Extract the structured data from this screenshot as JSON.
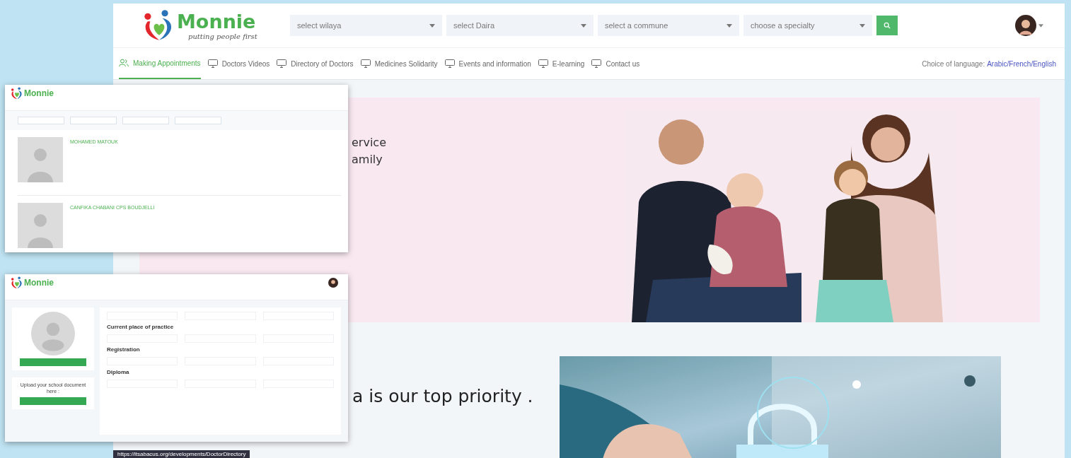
{
  "main_window": {
    "logo": {
      "name": "Monnie",
      "tagline": "putting people first"
    },
    "filters": [
      {
        "placeholder": "select wilaya"
      },
      {
        "placeholder": "select Daira"
      },
      {
        "placeholder": "select a commune"
      },
      {
        "placeholder": "choose a specialty"
      }
    ],
    "nav": [
      {
        "label": "Making Appointments",
        "kind": "people",
        "selected": true
      },
      {
        "label": "Doctors Videos",
        "kind": "screen",
        "selected": false
      },
      {
        "label": "Directory of Doctors",
        "kind": "screen",
        "selected": false
      },
      {
        "label": "Medicines Solidarity",
        "kind": "screen",
        "selected": false
      },
      {
        "label": "Events and information",
        "kind": "screen",
        "selected": false
      },
      {
        "label": "E-learning",
        "kind": "screen",
        "selected": false
      },
      {
        "label": "Contact us",
        "kind": "screen",
        "selected": false
      }
    ],
    "language_label": "Choice of language:",
    "languages": "Arabic/French/English",
    "hero_lines": [
      "ervice",
      "amily"
    ],
    "security_heading": "a is our top priority .",
    "status_url": "https://itsabacus.org/developments/DoctorDirectory"
  },
  "directory_screenshot": {
    "logo": {
      "name": "Monnie"
    },
    "doctors": [
      {
        "name": "MOHAMED MATOUK"
      },
      {
        "name": "CANFIKA CHABANI CPS BOUDJELLI"
      }
    ]
  },
  "profile_screenshot": {
    "logo": {
      "name": "Monnie"
    },
    "upload_label": "Upload your school document here :",
    "sections": [
      "Current place of practice",
      "Registration",
      "Diploma"
    ]
  }
}
